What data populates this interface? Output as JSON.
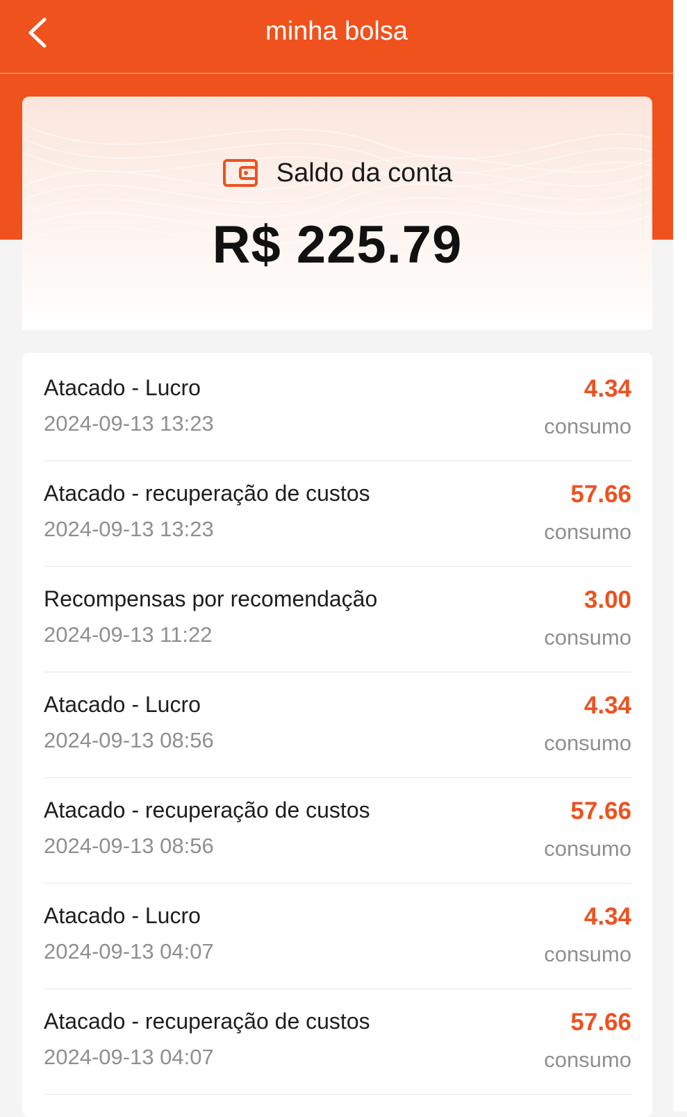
{
  "header": {
    "title": "minha bolsa",
    "back_icon": "chevron-left-icon"
  },
  "balance": {
    "icon": "wallet-icon",
    "label": "Saldo da conta",
    "amount": "R$ 225.79"
  },
  "colors": {
    "brand": "#f0521d",
    "amount": "#ec5220",
    "muted": "#8f8f8f"
  },
  "transactions": [
    {
      "title": "Atacado - Lucro",
      "date": "2024-09-13 13:23",
      "amount": "4.34",
      "type": "consumo"
    },
    {
      "title": "Atacado - recuperação de custos",
      "date": "2024-09-13 13:23",
      "amount": "57.66",
      "type": "consumo"
    },
    {
      "title": "Recompensas por recomendação",
      "date": "2024-09-13 11:22",
      "amount": "3.00",
      "type": "consumo"
    },
    {
      "title": "Atacado - Lucro",
      "date": "2024-09-13 08:56",
      "amount": "4.34",
      "type": "consumo"
    },
    {
      "title": "Atacado - recuperação de custos",
      "date": "2024-09-13 08:56",
      "amount": "57.66",
      "type": "consumo"
    },
    {
      "title": "Atacado - Lucro",
      "date": "2024-09-13 04:07",
      "amount": "4.34",
      "type": "consumo"
    },
    {
      "title": "Atacado - recuperação de custos",
      "date": "2024-09-13 04:07",
      "amount": "57.66",
      "type": "consumo"
    }
  ]
}
